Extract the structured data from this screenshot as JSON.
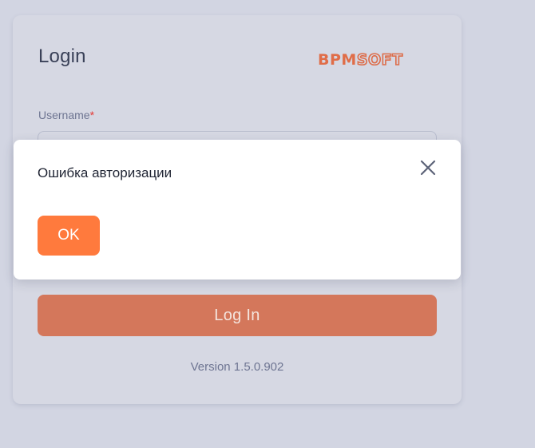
{
  "login": {
    "title": "Login",
    "brand": {
      "part_a": "BPM",
      "part_b": "SOFT"
    },
    "username_label": "Username",
    "required_mark": "*",
    "username_value": "",
    "login_button": "Log In",
    "version": "Version 1.5.0.902"
  },
  "dialog": {
    "message": "Ошибка авторизации",
    "ok_label": "OK",
    "close_icon": "close-icon"
  },
  "colors": {
    "background": "#d2d5e2",
    "card": "#d6d8e3",
    "accent": "#ff7a3d",
    "login_button": "#d4775b",
    "muted_text": "#6e7592",
    "title_text": "#3a4158"
  }
}
